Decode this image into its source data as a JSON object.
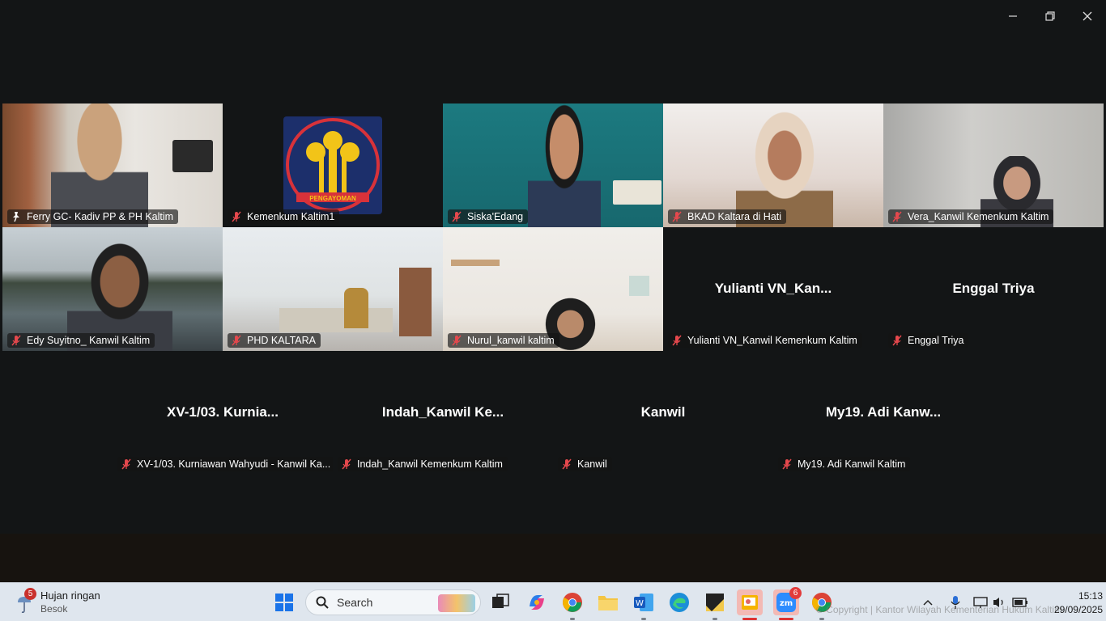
{
  "window": {
    "controls": {
      "minimize": "minimize-icon",
      "restore": "restore-icon",
      "close": "close-icon"
    }
  },
  "participants": [
    {
      "label": "Ferry GC- Kadiv PP & PH Kaltim",
      "mic": "pinned"
    },
    {
      "label": "Kemenkum Kaltim1",
      "mic": "muted",
      "logo_text": "PENGAYOMAN"
    },
    {
      "label": "Siska'Edang",
      "mic": "muted"
    },
    {
      "label": "BKAD Kaltara di Hati",
      "mic": "muted"
    },
    {
      "label": "Vera_Kanwil Kemenkum Kaltim",
      "mic": "muted"
    },
    {
      "label": "Edy Suyitno_ Kanwil Kaltim",
      "mic": "muted"
    },
    {
      "label": "PHD KALTARA",
      "mic": "muted"
    },
    {
      "label": "Nurul_kanwil kaltim",
      "mic": "muted"
    },
    {
      "label": "Yulianti VN_Kanwil Kemenkum Kaltim",
      "mic": "muted",
      "display": "Yulianti  VN_Kan..."
    },
    {
      "label": "Enggal Triya",
      "mic": "muted",
      "display": "Enggal Triya"
    },
    {
      "label": "XV-1/03. Kurniawan Wahyudi - Kanwil Ka...",
      "mic": "muted",
      "display": "XV-1/03.  Kurnia..."
    },
    {
      "label": "Indah_Kanwil Kemenkum Kaltim",
      "mic": "muted",
      "display": "Indah_Kanwil  Ke..."
    },
    {
      "label": "Kanwil",
      "mic": "muted",
      "display": "Kanwil"
    },
    {
      "label": "My19. Adi Kanwil Kaltim",
      "mic": "muted",
      "display": "My19.  Adi  Kanw..."
    }
  ],
  "taskbar": {
    "weather": {
      "title": "Hujan ringan",
      "subtitle": "Besok",
      "badge": "5"
    },
    "search_label": "Search",
    "zoom_badge": "6",
    "watermark": "© Copyright | Kantor Wilayah Kementerian Hukum Kaltim",
    "time": "15:13",
    "date": "29/09/2025"
  },
  "colors": {
    "active_speaker": "#3ddc84",
    "muted_mic": "#e5484d",
    "taskbar": "#dfe6ee"
  }
}
